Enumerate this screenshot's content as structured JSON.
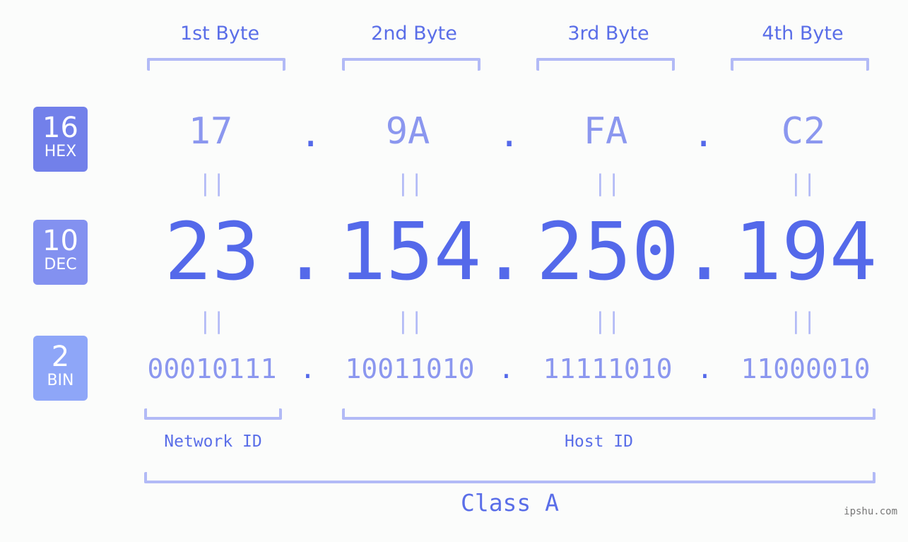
{
  "bytes": [
    {
      "label": "1st Byte",
      "hex": "17",
      "dec": "23",
      "bin": "00010111"
    },
    {
      "label": "2nd Byte",
      "hex": "9A",
      "dec": "154",
      "bin": "10011010"
    },
    {
      "label": "3rd Byte",
      "hex": "FA",
      "dec": "250",
      "bin": "11111010"
    },
    {
      "label": "4th Byte",
      "hex": "C2",
      "dec": "194",
      "bin": "11000010"
    }
  ],
  "badges": {
    "hex": {
      "number": "16",
      "label": "HEX",
      "color": "#7280ea"
    },
    "dec": {
      "number": "10",
      "label": "DEC",
      "color": "#8391f0"
    },
    "bin": {
      "number": "2",
      "label": "BIN",
      "color": "#8ea6f8"
    }
  },
  "separator": ".",
  "equals": "||",
  "network_id_label": "Network ID",
  "host_id_label": "Host ID",
  "class_label": "Class A",
  "watermark": "ipshu.com"
}
